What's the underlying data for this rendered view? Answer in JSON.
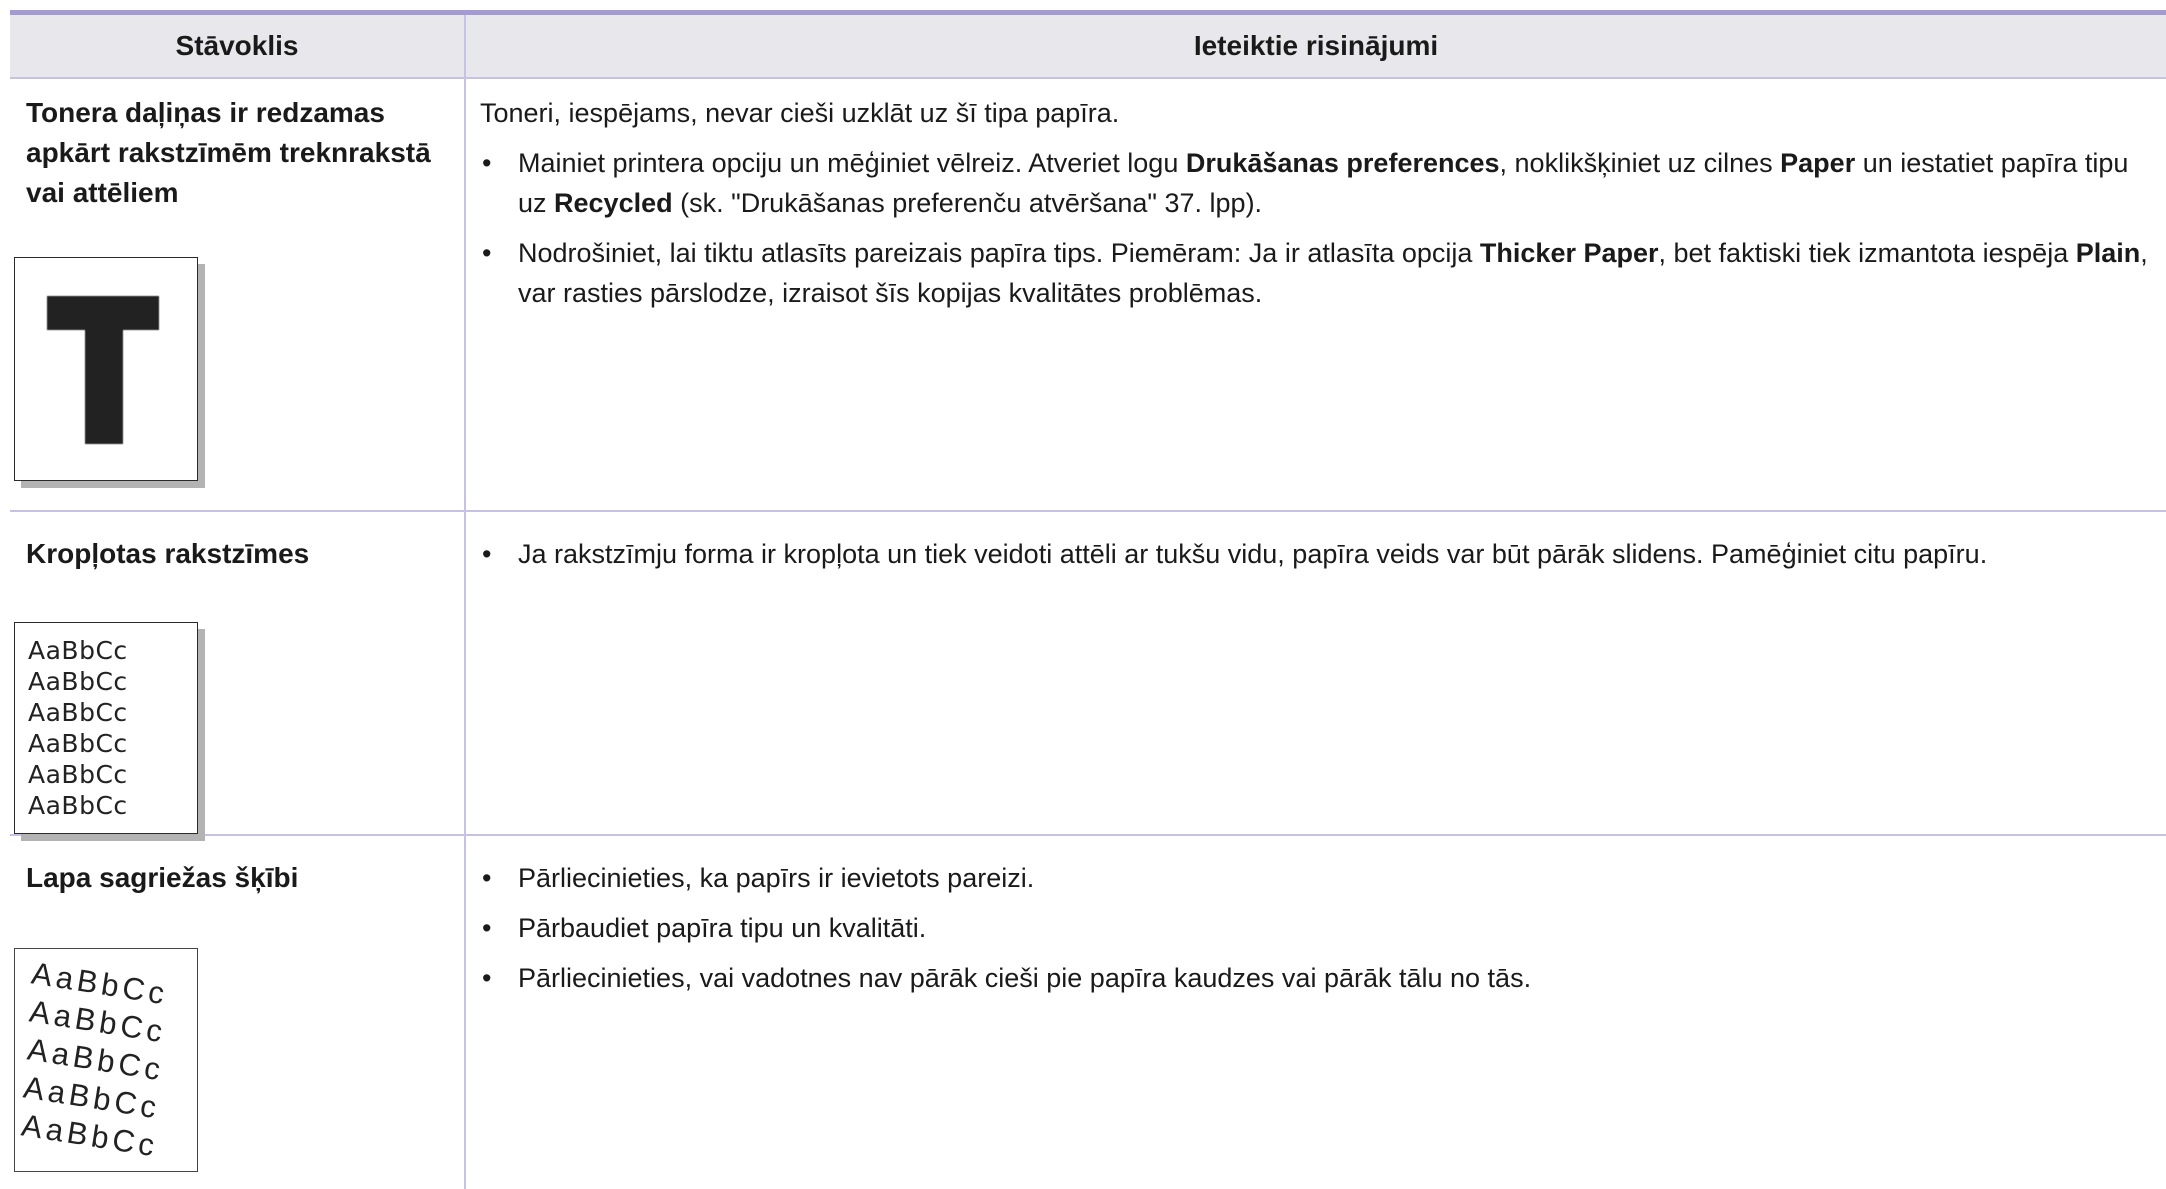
{
  "header": {
    "col1": "Stāvoklis",
    "col2": "Ieteiktie risinājumi"
  },
  "rows": [
    {
      "condition": "Tonera daļiņas ir redzamas apkārt rakstzīmēm treknrakstā vai attēliem",
      "sample_letter": "T",
      "intro": "Toneri, iespējams, nevar cieši uzklāt uz šī tipa papīra.",
      "bullets": [
        {
          "t1": "Mainiet printera opciju un mēģiniet vēlreiz. Atveriet logu ",
          "b1": "Drukāšanas preferences",
          "t2": ", noklikšķiniet uz cilnes ",
          "b2": "Paper",
          "t3": " un iestatiet papīra tipu uz ",
          "b3": "Recycled",
          "t4": " (sk. \"Drukāšanas preferenču atvēršana\" 37. lpp)."
        },
        {
          "t1": "Nodrošiniet, lai tiktu atlasīts pareizais papīra tips. Piemēram: Ja ir atlasīta opcija ",
          "b1": "Thicker Paper",
          "t2": ", bet faktiski tiek izmantota iespēja ",
          "b2": "Plain",
          "t3": ", var rasties pārslodze, izraisot šīs kopijas kvalitātes problēmas."
        }
      ]
    },
    {
      "condition": "Kropļotas rakstzīmes",
      "sample_lines": [
        "AaBbCc",
        "AaBbCc",
        "AaBbCc",
        "AaBbCc",
        "AaBbCc",
        "AaBbCc"
      ],
      "bullets": [
        "Ja rakstzīmju forma ir kropļota un tiek veidoti attēli ar tukšu vidu, papīra veids var būt pārāk slidens. Pamēģiniet citu papīru."
      ]
    },
    {
      "condition": "Lapa sagriežas šķībi",
      "sample_lines": [
        "AaBbCc",
        "AaBbCc",
        "AaBbCc",
        "AaBbCc",
        "AaBbCc"
      ],
      "bullets": [
        "Pārliecinieties, ka papīrs ir ievietots pareizi.",
        "Pārbaudiet papīra tipu un kvalitāti.",
        "Pārliecinieties, vai vadotnes nav pārāk cieši pie papīra kaudzes vai pārāk tālu no tās."
      ]
    }
  ],
  "bullet_char": "•"
}
